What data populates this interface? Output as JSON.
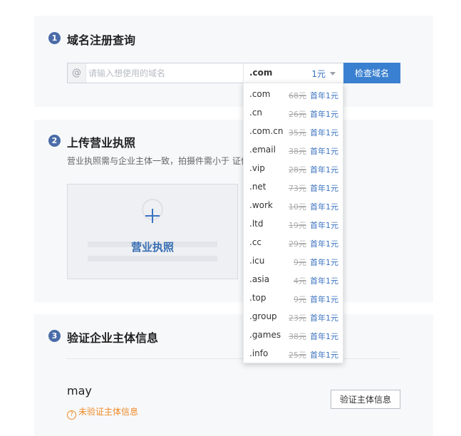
{
  "section1": {
    "num": "1",
    "title": "域名注册查询",
    "at_symbol": "@",
    "placeholder": "请输入想使用的域名",
    "selected_tld": ".com",
    "selected_price": "1元",
    "check_button": "检查域名"
  },
  "section2": {
    "num": "2",
    "title": "上传营业执照",
    "description": "营业执照需与企业主体一致，拍摄件需小于                          证件完整。",
    "upload_label": "营业执照"
  },
  "section3": {
    "num": "3",
    "title": "验证企业主体信息",
    "company_name": "may",
    "status_text": "未验证主体信息",
    "verify_button": "验证主体信息"
  },
  "dropdown": {
    "items": [
      {
        "tld": ".com",
        "old_price": "68元",
        "new_price": "首年1元"
      },
      {
        "tld": ".cn",
        "old_price": "26元",
        "new_price": "首年1元"
      },
      {
        "tld": ".com.cn",
        "old_price": "35元",
        "new_price": "首年1元"
      },
      {
        "tld": ".email",
        "old_price": "38元",
        "new_price": "首年1元"
      },
      {
        "tld": ".vip",
        "old_price": "28元",
        "new_price": "首年1元"
      },
      {
        "tld": ".net",
        "old_price": "73元",
        "new_price": "首年1元"
      },
      {
        "tld": ".work",
        "old_price": "10元",
        "new_price": "首年1元"
      },
      {
        "tld": ".ltd",
        "old_price": "19元",
        "new_price": "首年1元"
      },
      {
        "tld": ".cc",
        "old_price": "29元",
        "new_price": "首年1元"
      },
      {
        "tld": ".icu",
        "old_price": "9元",
        "new_price": "首年1元"
      },
      {
        "tld": ".asia",
        "old_price": "4元",
        "new_price": "首年1元"
      },
      {
        "tld": ".top",
        "old_price": "9元",
        "new_price": "首年1元"
      },
      {
        "tld": ".group",
        "old_price": "23元",
        "new_price": "首年1元"
      },
      {
        "tld": ".games",
        "old_price": "38元",
        "new_price": "首年1元"
      },
      {
        "tld": ".info",
        "old_price": "25元",
        "new_price": "首年1元"
      }
    ]
  },
  "colors": {
    "accent": "#3a80d0",
    "step_badge": "#4a6ca8",
    "warning": "#f08a24",
    "panel_bg": "#f7f8fa"
  }
}
